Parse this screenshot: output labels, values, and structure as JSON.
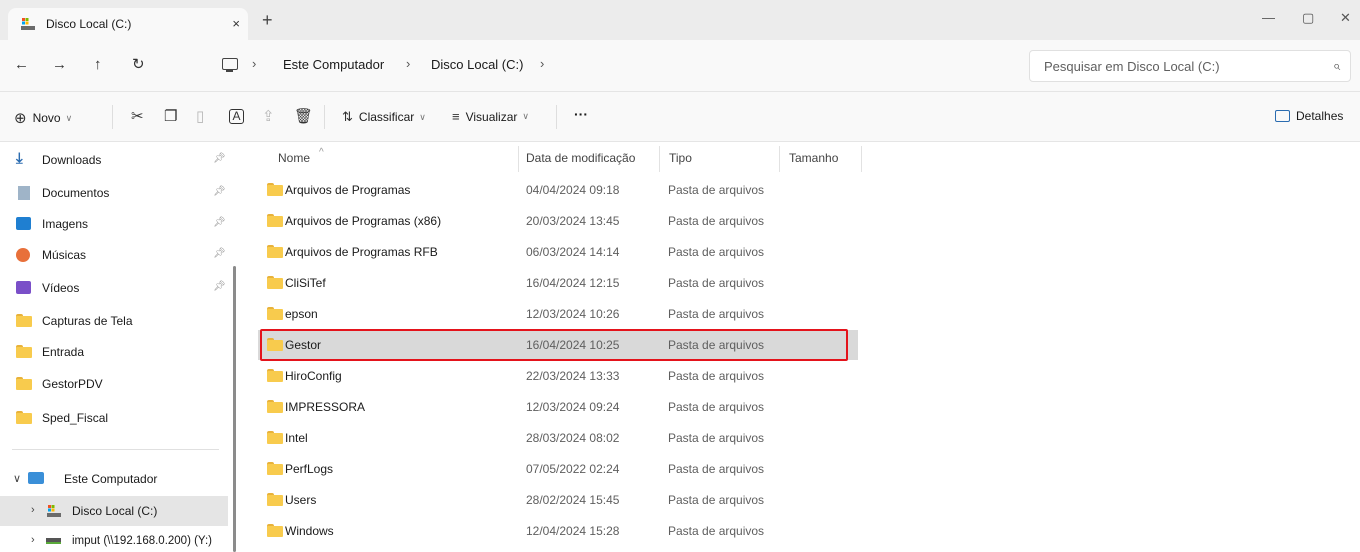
{
  "window": {
    "tab_title": "Disco Local (C:)",
    "tab_close": "×",
    "new_tab": "+",
    "minimize": "—",
    "maximize": "▢",
    "close": "✕"
  },
  "nav": {
    "back": "←",
    "forward": "→",
    "up": "↑",
    "refresh": "↻",
    "breadcrumb": [
      "Este Computador",
      "Disco Local (C:)"
    ],
    "separator": "›",
    "search_placeholder": "Pesquisar em Disco Local (C:)"
  },
  "toolbar": {
    "new_label": "Novo",
    "sort_label": "Classificar",
    "view_label": "Visualizar",
    "more_label": "···",
    "details_label": "Detalhes",
    "icons": [
      "new-icon",
      "cut-icon",
      "copy-icon",
      "paste-icon",
      "rename-icon",
      "share-icon",
      "delete-icon",
      "sort-icon",
      "view-icon",
      "details-icon"
    ]
  },
  "sidebar": {
    "quick_access": [
      {
        "label": "Downloads",
        "icon": "download-icon",
        "pinned": true
      },
      {
        "label": "Documentos",
        "icon": "documents-icon",
        "pinned": true
      },
      {
        "label": "Imagens",
        "icon": "pictures-icon",
        "pinned": true
      },
      {
        "label": "Músicas",
        "icon": "music-icon",
        "pinned": true
      },
      {
        "label": "Vídeos",
        "icon": "videos-icon",
        "pinned": true
      },
      {
        "label": "Capturas de Tela",
        "icon": "folder-icon",
        "pinned": false
      },
      {
        "label": "Entrada",
        "icon": "folder-icon",
        "pinned": false
      },
      {
        "label": "GestorPDV",
        "icon": "folder-icon",
        "pinned": false
      },
      {
        "label": "Sped_Fiscal",
        "icon": "folder-icon",
        "pinned": false
      }
    ],
    "this_pc": "Este Computador",
    "local_disk": "Disco Local (C:)",
    "network_drive": "imput (\\\\192.168.0.200) (Y:)"
  },
  "columns": {
    "name": "Nome",
    "date": "Data de modificação",
    "type": "Tipo",
    "size": "Tamanho"
  },
  "files": [
    {
      "name": "Arquivos de Programas",
      "date": "04/04/2024 09:18",
      "type": "Pasta de arquivos"
    },
    {
      "name": "Arquivos de Programas (x86)",
      "date": "20/03/2024 13:45",
      "type": "Pasta de arquivos"
    },
    {
      "name": "Arquivos de Programas RFB",
      "date": "06/03/2024 14:14",
      "type": "Pasta de arquivos"
    },
    {
      "name": "CliSiTef",
      "date": "16/04/2024 12:15",
      "type": "Pasta de arquivos"
    },
    {
      "name": "epson",
      "date": "12/03/2024 10:26",
      "type": "Pasta de arquivos"
    },
    {
      "name": "Gestor",
      "date": "16/04/2024 10:25",
      "type": "Pasta de arquivos"
    },
    {
      "name": "HiroConfig",
      "date": "22/03/2024 13:33",
      "type": "Pasta de arquivos"
    },
    {
      "name": "IMPRESSORA",
      "date": "12/03/2024 09:24",
      "type": "Pasta de arquivos"
    },
    {
      "name": "Intel",
      "date": "28/03/2024 08:02",
      "type": "Pasta de arquivos"
    },
    {
      "name": "PerfLogs",
      "date": "07/05/2022 02:24",
      "type": "Pasta de arquivos"
    },
    {
      "name": "Users",
      "date": "28/02/2024 15:45",
      "type": "Pasta de arquivos"
    },
    {
      "name": "Windows",
      "date": "12/04/2024 15:28",
      "type": "Pasta de arquivos"
    }
  ],
  "selected_file": "Gestor",
  "colors": {
    "highlight_border": "#e4131b",
    "selected_row": "#d9d9d9",
    "folder": "#f8cb4d"
  }
}
